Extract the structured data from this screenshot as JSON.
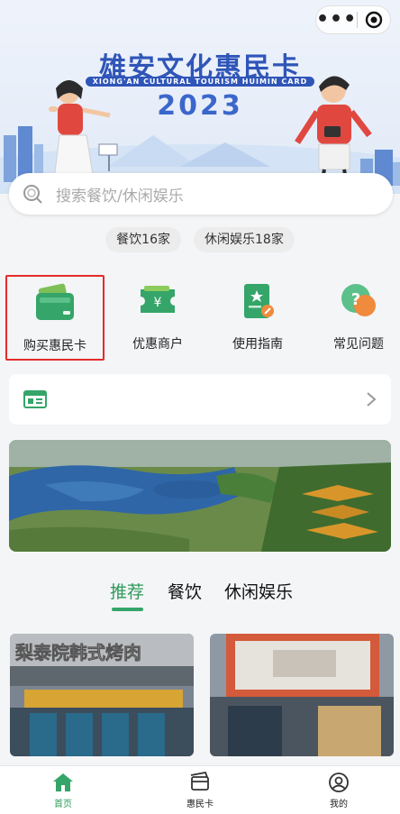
{
  "header": {
    "title": "雄安文化惠民卡",
    "subtitle": "XIONG'AN CULTURAL TOURISM HUIMIN CARD",
    "year": "2023",
    "menu_dots": "•••"
  },
  "search": {
    "placeholder": "搜索餐饮/休闲娱乐"
  },
  "chips": [
    {
      "label": "餐饮16家"
    },
    {
      "label": "休闲娱乐18家"
    }
  ],
  "quick_menu": [
    {
      "label": "购买惠民卡",
      "icon": "card-wallet-icon"
    },
    {
      "label": "优惠商户",
      "icon": "coupon-ticket-icon"
    },
    {
      "label": "使用指南",
      "icon": "guide-book-icon"
    },
    {
      "label": "常见问题",
      "icon": "faq-chat-icon"
    }
  ],
  "tabs": [
    {
      "label": "推荐",
      "active": true
    },
    {
      "label": "餐饮"
    },
    {
      "label": "休闲娱乐"
    }
  ],
  "cards": [
    {
      "storefront_sign": "梨泰院韩式烤肉"
    },
    {
      "storefront_sign": ""
    }
  ],
  "bottom_nav": [
    {
      "label": "首页",
      "icon": "home-icon",
      "active": true
    },
    {
      "label": "惠民卡",
      "icon": "card-icon"
    },
    {
      "label": "我的",
      "icon": "user-icon"
    }
  ],
  "colors": {
    "accent_green": "#35a569",
    "title_blue": "#2f55b8",
    "highlight_red": "#e52a2a"
  }
}
